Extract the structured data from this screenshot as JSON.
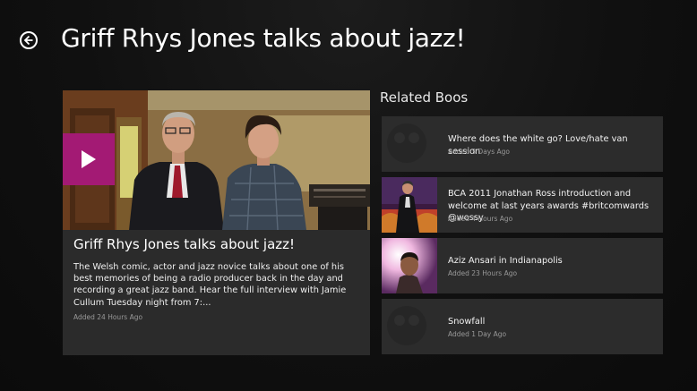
{
  "header": {
    "title": "Griff Rhys Jones talks about jazz!"
  },
  "featured": {
    "title": "Griff Rhys Jones talks about jazz!",
    "description": "The Welsh comic, actor and jazz novice talks about one of his best memories of being a radio producer back in the day and recording a great jazz band. Hear the full interview with Jamie Cullum Tuesday night from 7:...",
    "added": "Added 24 Hours Ago"
  },
  "related": {
    "heading": "Related Boos",
    "items": [
      {
        "title": "Where does the white go? Love/hate van session",
        "added": "Added 3 Days Ago"
      },
      {
        "title": "BCA 2011 Jonathan Ross introduction and welcome at last years awards #britcomwards @wossy",
        "added": "Added 4 Hours Ago"
      },
      {
        "title": "Aziz Ansari in Indianapolis",
        "added": "Added 23 Hours Ago"
      },
      {
        "title": "Snowfall",
        "added": "Added 1 Day Ago"
      }
    ]
  },
  "colors": {
    "accent": "#a31a74",
    "tile": "#2b2b2b",
    "background": "#111111"
  },
  "icons": {
    "back": "back-arrow-icon",
    "play": "play-icon"
  }
}
